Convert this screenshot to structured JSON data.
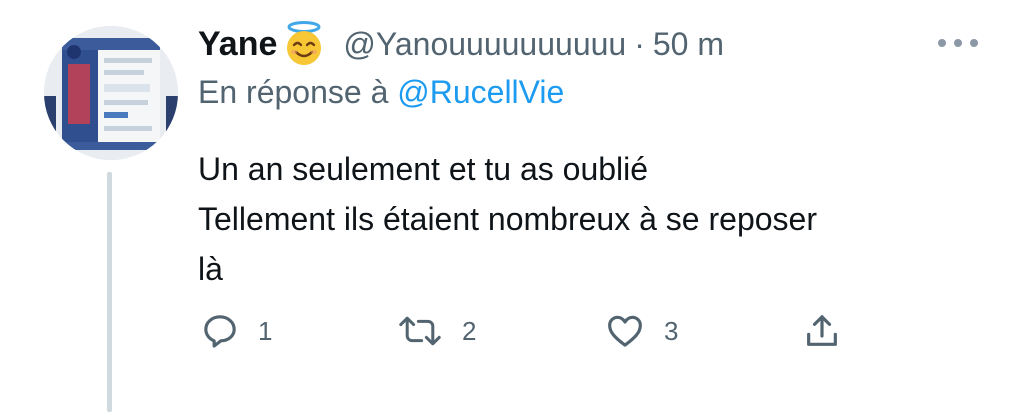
{
  "tweet": {
    "author_name": "Yane",
    "author_emoji": "smiling-face-with-halo-emoji",
    "handle": "@Yanouuuuuuuuuu",
    "separator": "·",
    "time": "50 m",
    "reply_prefix": "En réponse à",
    "reply_mention": "@RucellVie",
    "text_lines": [
      "Un an seulement et tu as oublié",
      "Tellement ils étaient nombreux à se reposer",
      "là"
    ]
  },
  "actions": {
    "reply_count": "1",
    "retweet_count": "2",
    "like_count": "3"
  },
  "icons": {
    "more": "more-horizontal-icon",
    "reply": "reply-icon",
    "retweet": "retweet-icon",
    "like": "heart-icon",
    "share": "share-icon"
  },
  "colors": {
    "text": "#0f1419",
    "secondary": "#536471",
    "link": "#1d9bf0",
    "thread_line": "#cfd9de"
  }
}
